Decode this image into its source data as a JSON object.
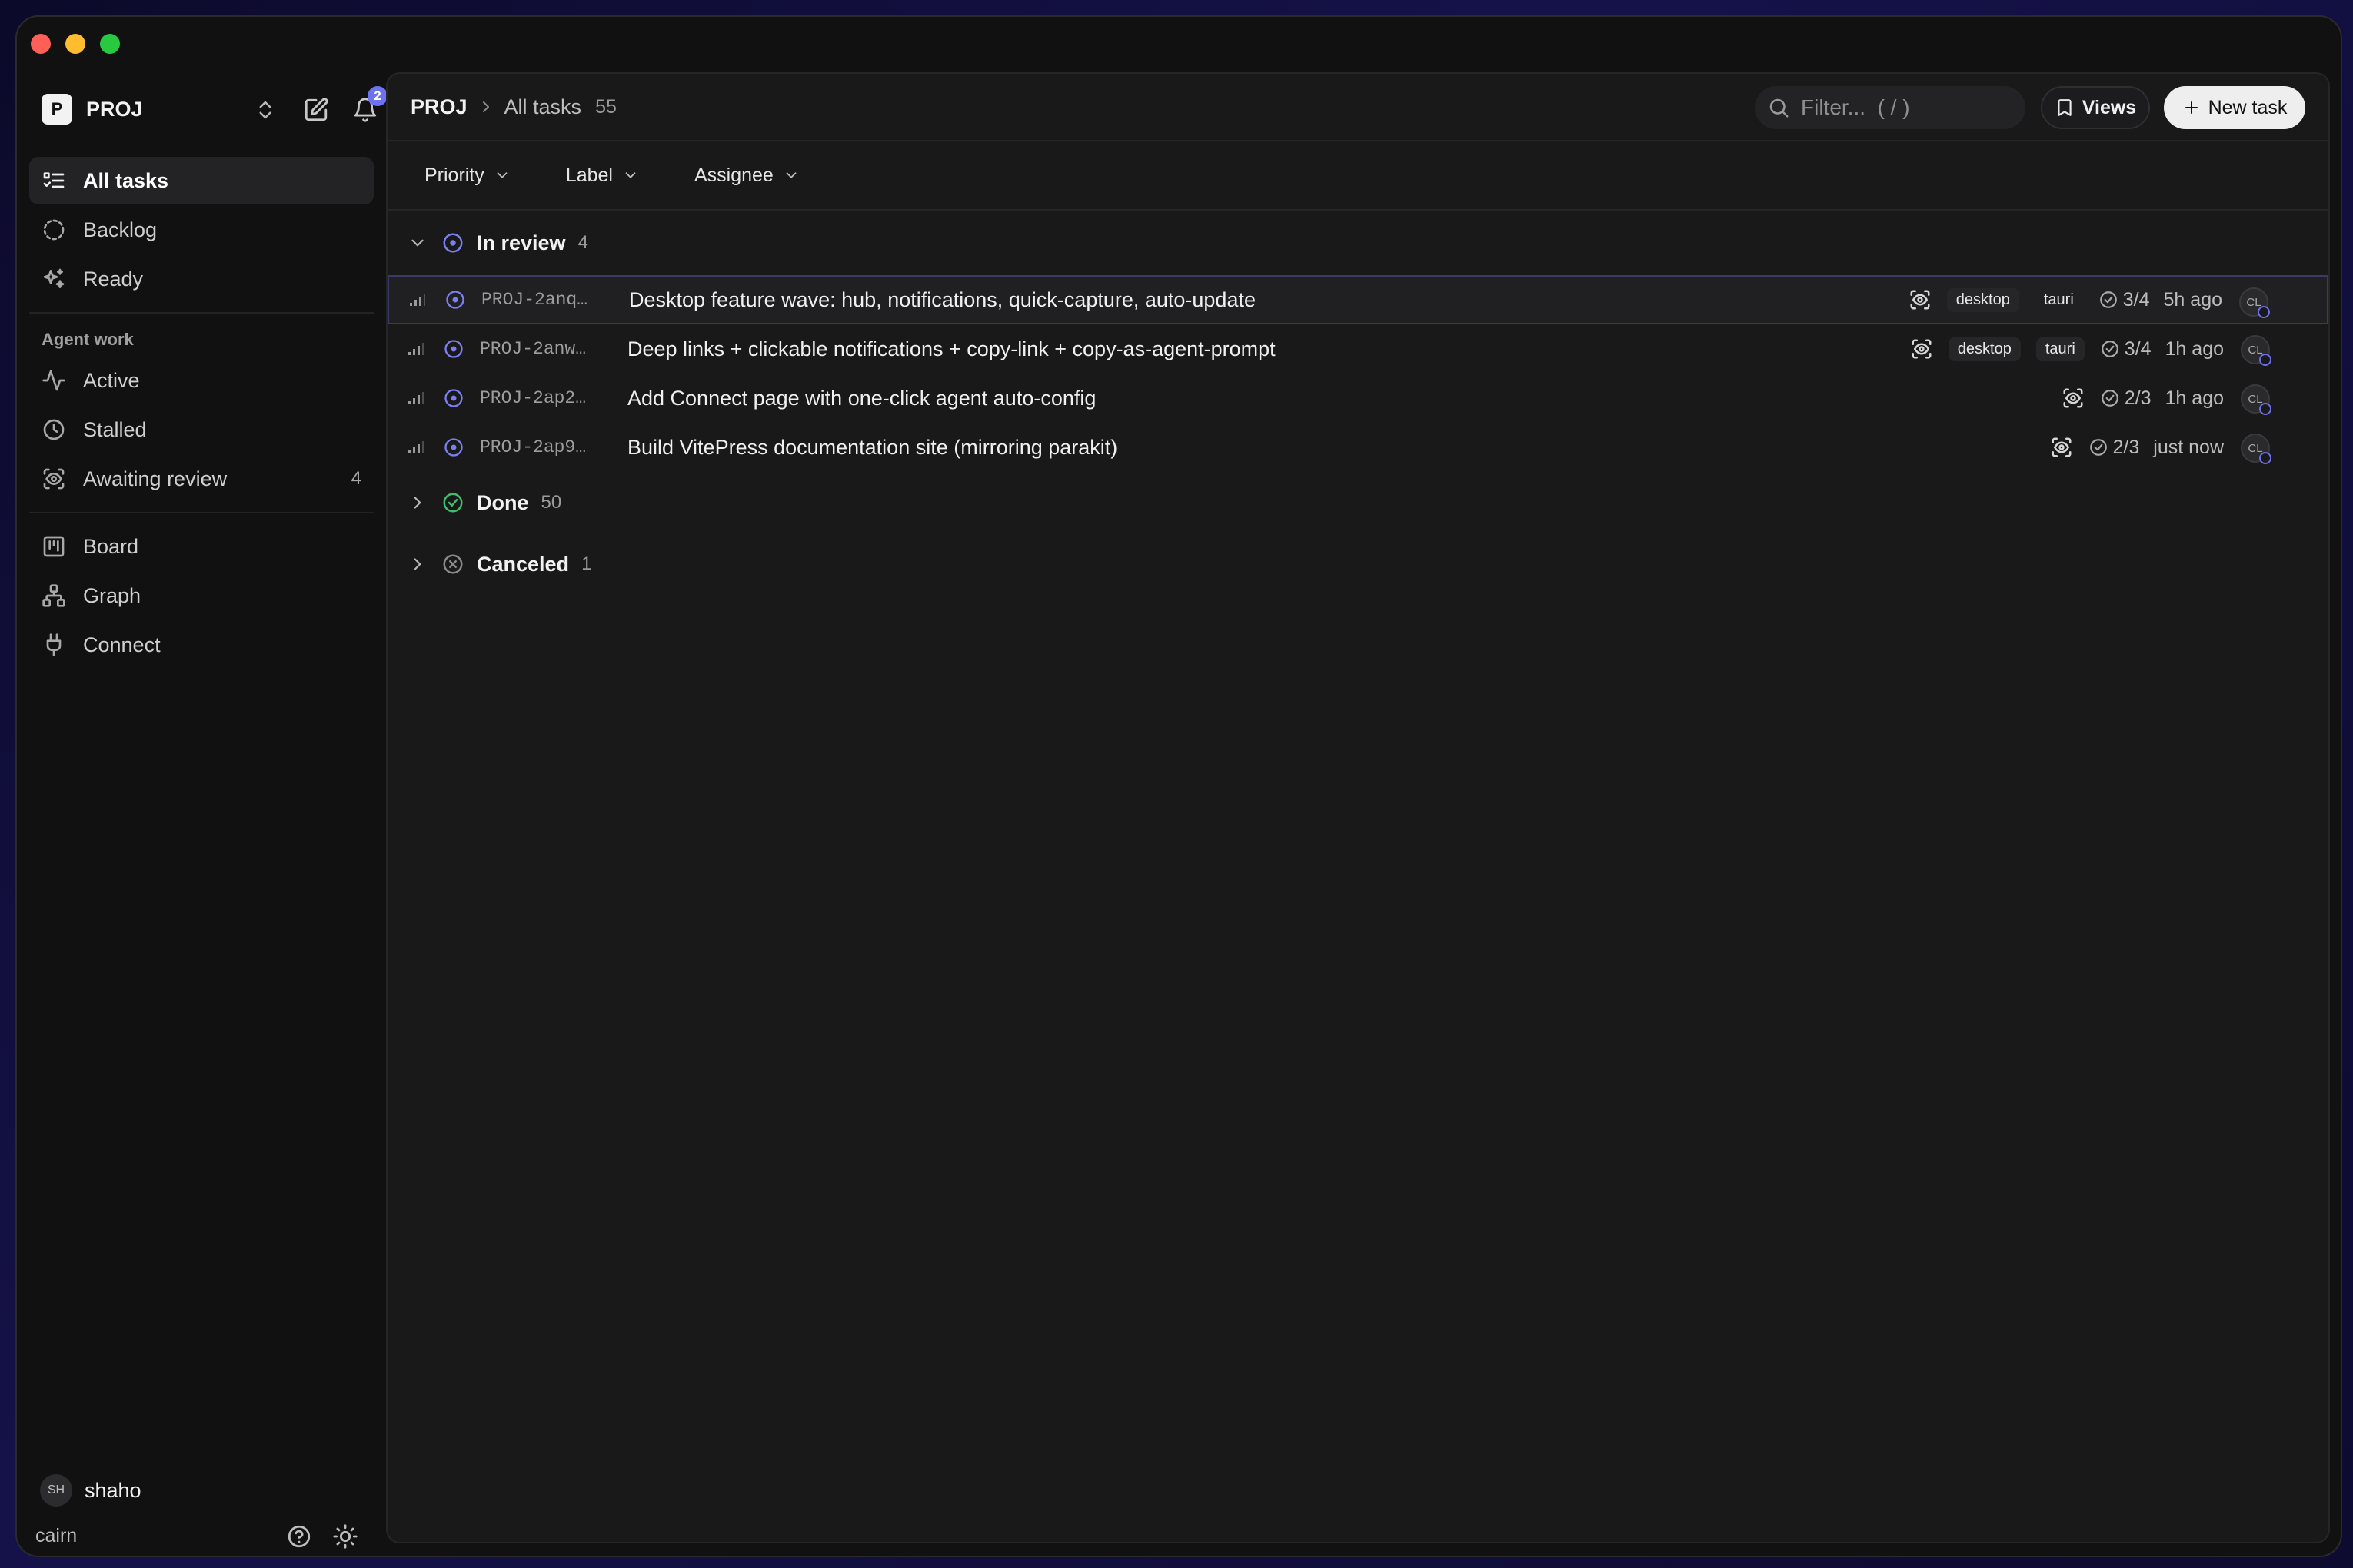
{
  "workspace": {
    "badge": "P",
    "name": "PROJ",
    "notifications": "2"
  },
  "sidebar": {
    "items": [
      {
        "label": "All tasks",
        "icon": "list-check-icon"
      },
      {
        "label": "Backlog",
        "icon": "circle-dashed-icon"
      },
      {
        "label": "Ready",
        "icon": "sparkle-icon"
      }
    ],
    "agent_heading": "Agent work",
    "agent_items": [
      {
        "label": "Active",
        "icon": "activity-icon"
      },
      {
        "label": "Stalled",
        "icon": "clock-icon"
      },
      {
        "label": "Awaiting review",
        "icon": "scan-eye-icon",
        "count": "4"
      }
    ],
    "other_items": [
      {
        "label": "Board",
        "icon": "kanban-icon"
      },
      {
        "label": "Graph",
        "icon": "network-icon"
      },
      {
        "label": "Connect",
        "icon": "plug-icon"
      }
    ]
  },
  "user": {
    "initials": "SH",
    "name": "shaho"
  },
  "footer": {
    "app": "cairn"
  },
  "header": {
    "crumb_root": "PROJ",
    "crumb_page": "All tasks",
    "crumb_count": "55",
    "search_placeholder": "Filter...  ( / )",
    "views_label": "Views",
    "new_task_label": "New task"
  },
  "filters": [
    "Priority",
    "Label",
    "Assignee"
  ],
  "groups": [
    {
      "label": "In review",
      "count": "4",
      "expanded": true,
      "status_color": "#7b7ff0"
    },
    {
      "label": "Done",
      "count": "50",
      "expanded": false,
      "status_color": "#3fbf6a"
    },
    {
      "label": "Canceled",
      "count": "1",
      "expanded": false,
      "status_color": "#8a8a8a"
    }
  ],
  "tasks": [
    {
      "id": "PROJ-2anq…",
      "title": "Desktop feature wave: hub, notifications, quick-capture, auto-update",
      "tags": [
        "desktop",
        "tauri"
      ],
      "progress": "3/4",
      "time": "5h ago",
      "assignee": "CL"
    },
    {
      "id": "PROJ-2anw…",
      "title": "Deep links + clickable notifications + copy-link + copy-as-agent-prompt",
      "tags": [
        "desktop",
        "tauri"
      ],
      "progress": "3/4",
      "time": "1h ago",
      "assignee": "CL"
    },
    {
      "id": "PROJ-2ap2…",
      "title": "Add Connect page with one-click agent auto-config",
      "tags": [],
      "progress": "2/3",
      "time": "1h ago",
      "assignee": "CL"
    },
    {
      "id": "PROJ-2ap9…",
      "title": "Build VitePress documentation site (mirroring parakit)",
      "tags": [],
      "progress": "2/3",
      "time": "just now",
      "assignee": "CL"
    }
  ]
}
